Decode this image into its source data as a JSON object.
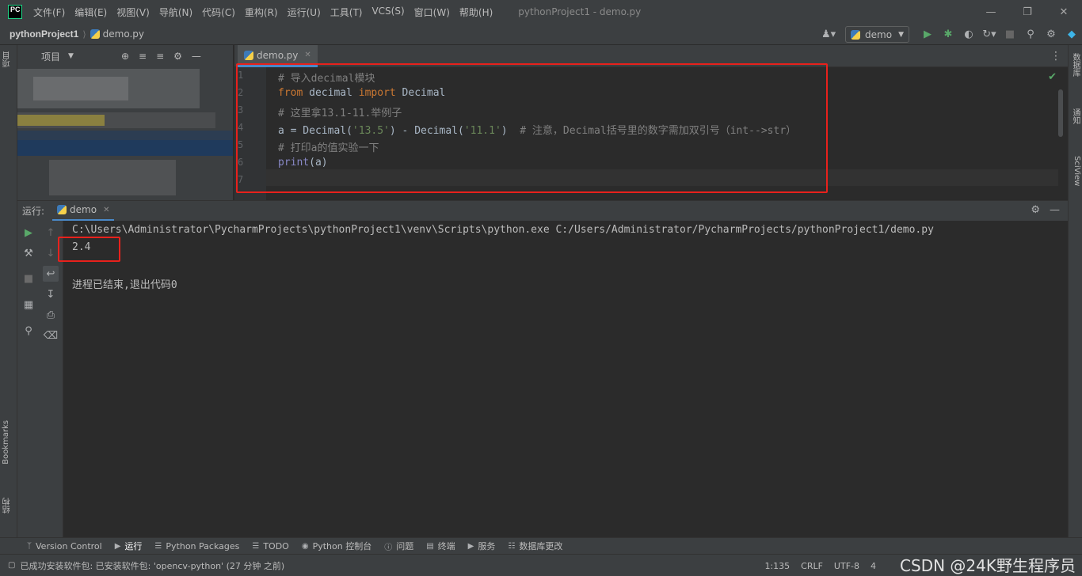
{
  "menubar": {
    "items": [
      "文件(F)",
      "编辑(E)",
      "视图(V)",
      "导航(N)",
      "代码(C)",
      "重构(R)",
      "运行(U)",
      "工具(T)",
      "VCS(S)",
      "窗口(W)",
      "帮助(H)"
    ],
    "window_title": "pythonProject1 - demo.py",
    "logo_text": "PC"
  },
  "navbar": {
    "project": "pythonProject1",
    "file": "demo.py",
    "run_config": "demo"
  },
  "project_panel": {
    "title": "项目"
  },
  "editor": {
    "tab_label": "demo.py",
    "line_numbers": [
      "1",
      "2",
      "3",
      "4",
      "5",
      "6",
      "7"
    ],
    "lines": [
      [
        {
          "t": "# 导入decimal模块",
          "c": "cmt"
        }
      ],
      [
        {
          "t": "from",
          "c": "kw"
        },
        {
          "t": " decimal ",
          "c": ""
        },
        {
          "t": "import",
          "c": "kw"
        },
        {
          "t": " Decimal",
          "c": ""
        }
      ],
      [
        {
          "t": "# 这里拿13.1-11.举例子",
          "c": "cmt"
        }
      ],
      [
        {
          "t": "a = Decimal(",
          "c": ""
        },
        {
          "t": "'13.5'",
          "c": "str"
        },
        {
          "t": ") - Decimal(",
          "c": ""
        },
        {
          "t": "'11.1'",
          "c": "str"
        },
        {
          "t": ")  ",
          "c": ""
        },
        {
          "t": "# 注意，Decimal括号里的数字需加双引号（int-->str）",
          "c": "cmt"
        }
      ],
      [
        {
          "t": "# 打印a的值实验一下",
          "c": "cmt"
        }
      ],
      [
        {
          "t": "print",
          "c": "fn"
        },
        {
          "t": "(a)",
          "c": ""
        }
      ],
      []
    ]
  },
  "right_stripe": {
    "tabs": [
      "数据库",
      "通知",
      "SciView"
    ]
  },
  "left_stripe": {
    "tabs": [
      "项目",
      "Bookmarks",
      "结构"
    ]
  },
  "run_panel": {
    "label": "运行:",
    "tab_label": "demo",
    "console": [
      "C:\\Users\\Administrator\\PycharmProjects\\pythonProject1\\venv\\Scripts\\python.exe C:/Users/Administrator/PycharmProjects/pythonProject1/demo.py",
      "2.4",
      "",
      "进程已结束,退出代码0"
    ]
  },
  "toolwindows": [
    {
      "label": "Version Control",
      "icon": "branch-icon"
    },
    {
      "label": "运行",
      "icon": "run-icon"
    },
    {
      "label": "Python Packages",
      "icon": "layers-icon"
    },
    {
      "label": "TODO",
      "icon": "list-icon"
    },
    {
      "label": "Python 控制台",
      "icon": "console-icon"
    },
    {
      "label": "问题",
      "icon": "info-icon"
    },
    {
      "label": "终端",
      "icon": "terminal-icon"
    },
    {
      "label": "服务",
      "icon": "services-icon"
    },
    {
      "label": "数据库更改",
      "icon": "database-icon"
    }
  ],
  "statusbar": {
    "message": "已成功安装软件包: 已安装软件包: 'opencv-python' (27 分钟 之前)",
    "position": "1:135",
    "line_sep": "CRLF",
    "encoding": "UTF-8",
    "indent": "4",
    "watermark": "CSDN @24K野生程序员"
  },
  "colors": {
    "annotation_red": "#e8211c",
    "accent_blue": "#4a88c7",
    "keyword": "#cc7832",
    "string": "#6a8759",
    "comment": "#808080"
  }
}
